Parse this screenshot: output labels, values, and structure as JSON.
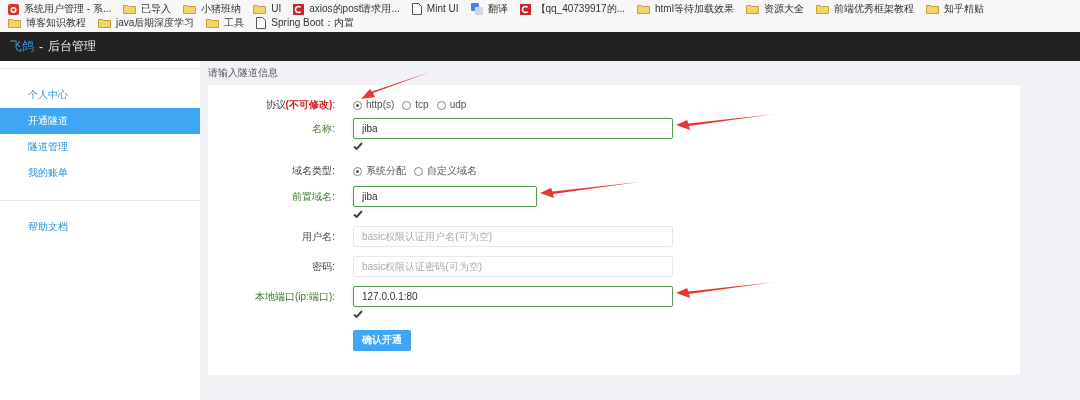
{
  "bookmarks": [
    {
      "kind": "site",
      "label": "系统用户管理 - 系..."
    },
    {
      "kind": "folder",
      "label": "已导入"
    },
    {
      "kind": "folder",
      "label": "小猪班纳"
    },
    {
      "kind": "folder",
      "label": "UI"
    },
    {
      "kind": "red-logo",
      "label": "axios的post请求用..."
    },
    {
      "kind": "page",
      "label": "Mint UI"
    },
    {
      "kind": "translate",
      "label": "翻译"
    },
    {
      "kind": "red-logo",
      "label": "【qq_40739917的..."
    },
    {
      "kind": "folder",
      "label": "html等待加载效果"
    },
    {
      "kind": "folder",
      "label": "资源大全"
    },
    {
      "kind": "folder",
      "label": "前端优秀框架教程"
    },
    {
      "kind": "folder",
      "label": "知乎精贴"
    },
    {
      "kind": "folder",
      "label": "博客知识教程"
    },
    {
      "kind": "folder",
      "label": "java后期深度学习"
    },
    {
      "kind": "folder",
      "label": "工具"
    },
    {
      "kind": "page",
      "label": "Spring Boot：内置"
    }
  ],
  "header": {
    "brand": "飞鸽",
    "separator": "-",
    "title": "后台管理"
  },
  "sidebar": {
    "groups": [
      [
        {
          "label": "个人中心",
          "selected": false
        },
        {
          "label": "开通隧道",
          "selected": true
        },
        {
          "label": "隧道管理",
          "selected": false
        },
        {
          "label": "我的账单",
          "selected": false
        }
      ],
      [
        {
          "label": "帮助文档",
          "selected": false
        }
      ]
    ]
  },
  "form": {
    "heading": "请输入隧道信息",
    "rows": [
      {
        "kind": "radio",
        "label": "协议**(不可修改)**:",
        "arrow": true,
        "options": [
          {
            "label": "http(s)",
            "selected": true
          },
          {
            "label": "tcp",
            "selected": false
          },
          {
            "label": "udp",
            "selected": false
          }
        ]
      },
      {
        "kind": "input",
        "label": "名称:",
        "value": "jiba",
        "valid": true,
        "arrow": true
      },
      {
        "kind": "radio",
        "label": "域名类型:",
        "arrow": false,
        "options": [
          {
            "label": "系统分配",
            "selected": true
          },
          {
            "label": "自定义域名",
            "selected": false
          }
        ]
      },
      {
        "kind": "prefix",
        "label": "前置域名:",
        "value": "jiba",
        "valid": true,
        "arrow": true
      },
      {
        "kind": "input",
        "label": "用户名:",
        "placeholder": "basic权限认证用户名(可为空)",
        "valid": false,
        "arrow": false
      },
      {
        "kind": "input",
        "label": "密码:",
        "placeholder": "basic权限认证密码(可为空)",
        "valid": false,
        "arrow": false
      },
      {
        "kind": "input",
        "label": "本地端口(ip:端口):",
        "value": "127.0.0.1:80",
        "valid": true,
        "arrow": true
      }
    ],
    "submit": "确认开通"
  }
}
